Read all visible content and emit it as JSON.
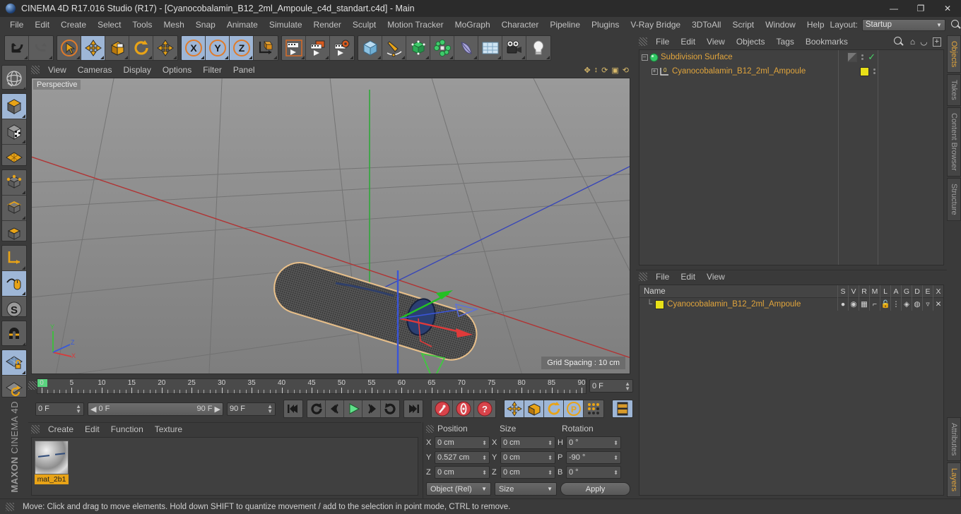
{
  "window": {
    "title": "CINEMA 4D R17.016 Studio (R17) - [Cyanocobalamin_B12_2ml_Ampoule_c4d_standart.c4d] - Main",
    "minimize": "—",
    "maximize": "❐",
    "close": "✕"
  },
  "menubar": {
    "items": [
      "File",
      "Edit",
      "Create",
      "Select",
      "Tools",
      "Mesh",
      "Snap",
      "Animate",
      "Simulate",
      "Render",
      "Sculpt",
      "Motion Tracker",
      "MoGraph",
      "Character",
      "Pipeline",
      "Plugins",
      "V-Ray Bridge",
      "3DToAll",
      "Script",
      "Window",
      "Help"
    ],
    "layout_label": "Layout:",
    "layout_value": "Startup"
  },
  "toolbar": {
    "groups": [
      {
        "buttons": [
          {
            "name": "undo-icon",
            "active": false
          },
          {
            "name": "redo-icon",
            "active": false
          }
        ]
      },
      {
        "buttons": [
          {
            "name": "live-selection-icon",
            "active": false
          },
          {
            "name": "move-tool-icon",
            "active": true
          },
          {
            "name": "scale-tool-icon",
            "active": false
          },
          {
            "name": "rotate-tool-icon",
            "active": false
          },
          {
            "name": "move-axis-icon",
            "active": false
          }
        ]
      },
      {
        "buttons": [
          {
            "name": "axis-x-icon",
            "active": true
          },
          {
            "name": "axis-y-icon",
            "active": true
          },
          {
            "name": "axis-z-icon",
            "active": true
          },
          {
            "name": "world-object-coordinate-icon",
            "active": false
          }
        ]
      },
      {
        "buttons": [
          {
            "name": "render-view-icon",
            "active": false
          },
          {
            "name": "render-to-picture-viewer-icon",
            "active": false
          },
          {
            "name": "render-settings-icon",
            "active": false
          }
        ]
      },
      {
        "buttons": [
          {
            "name": "cube-primitive-icon",
            "active": false
          },
          {
            "name": "spline-pen-icon",
            "active": false
          },
          {
            "name": "generator-nurbs-icon",
            "active": false
          },
          {
            "name": "mograph-icon",
            "active": false
          },
          {
            "name": "deformer-icon",
            "active": false
          },
          {
            "name": "floor-environment-icon",
            "active": false
          },
          {
            "name": "camera-icon",
            "active": false
          },
          {
            "name": "light-icon",
            "active": false
          }
        ]
      }
    ]
  },
  "lefttoolbar": {
    "groups": [
      {
        "buttons": [
          {
            "name": "make-editable-globe-icon",
            "active": false
          }
        ]
      },
      {
        "buttons": [
          {
            "name": "model-mode-icon",
            "active": true
          },
          {
            "name": "texture-mode-icon",
            "active": false
          },
          {
            "name": "workplane-mode-icon",
            "active": false
          }
        ]
      },
      {
        "buttons": [
          {
            "name": "points-mode-icon",
            "active": false
          },
          {
            "name": "edges-mode-icon",
            "active": false
          },
          {
            "name": "polygons-mode-icon",
            "active": false
          }
        ]
      },
      {
        "buttons": [
          {
            "name": "object-axis-mode-icon",
            "active": false
          },
          {
            "name": "enable-snapping-icon",
            "active": true
          },
          {
            "name": "soft-selection-icon",
            "active": false
          }
        ]
      },
      {
        "buttons": [
          {
            "name": "magnet-tool-icon",
            "active": false
          }
        ]
      },
      {
        "buttons": [
          {
            "name": "lock-workplane-icon",
            "active": true
          },
          {
            "name": "planar-workplane-icon",
            "active": false
          }
        ]
      }
    ],
    "brand_bold": "MAXON",
    "brand": "CINEMA 4D"
  },
  "viewport": {
    "menu": [
      "View",
      "Cameras",
      "Display",
      "Options",
      "Filter",
      "Panel"
    ],
    "view_label": "Perspective",
    "grid_spacing": "Grid Spacing : 10 cm",
    "axis_labels": {
      "x": "X",
      "y": "Y",
      "z": "Z"
    },
    "colors": {
      "axis_x": "#d83a3a",
      "axis_y": "#3ac13a",
      "axis_z": "#3a5ad8",
      "selection_outline": "#e9c08a",
      "background_top": "#9a9a9a",
      "background_bottom": "#7e7e7e"
    }
  },
  "timeline": {
    "ticks": [
      "0",
      "5",
      "10",
      "15",
      "20",
      "25",
      "30",
      "35",
      "40",
      "45",
      "50",
      "55",
      "60",
      "65",
      "70",
      "75",
      "80",
      "85",
      "90"
    ],
    "current_frame_right": "0 F",
    "start_field": "0 F",
    "range_start": "0 F",
    "range_end": "90 F",
    "end_field": "90 F",
    "transport": [
      {
        "name": "go-to-start-button"
      },
      {
        "name": "play-backwards-button"
      },
      {
        "name": "previous-frame-button"
      },
      {
        "name": "play-forwards-button"
      },
      {
        "name": "next-frame-button"
      },
      {
        "name": "loop-button"
      },
      {
        "name": "go-to-end-button"
      }
    ],
    "keyframe_buttons": [
      {
        "name": "record-active-objects-button"
      },
      {
        "name": "autokeying-button"
      },
      {
        "name": "keyframe-selection-button"
      }
    ],
    "key_toggles": [
      {
        "name": "key-position-icon",
        "active": true
      },
      {
        "name": "key-scale-icon",
        "active": true
      },
      {
        "name": "key-rotation-icon",
        "active": true
      },
      {
        "name": "key-param-icon",
        "active": true
      },
      {
        "name": "key-pla-icon",
        "active": false
      }
    ],
    "timeline_button": {
      "name": "timeline-button",
      "active": true
    }
  },
  "materials": {
    "menu": [
      "Create",
      "Edit",
      "Function",
      "Texture"
    ],
    "items": [
      {
        "name": "mat_2b1"
      }
    ]
  },
  "coordinates": {
    "headers": [
      "Position",
      "Size",
      "Rotation"
    ],
    "position": {
      "x_label": "X",
      "x": "0 cm",
      "y_label": "Y",
      "y": "0.527 cm",
      "z_label": "Z",
      "z": "0 cm"
    },
    "size": {
      "x_label": "X",
      "x": "0 cm",
      "y_label": "Y",
      "y": "0 cm",
      "z_label": "Z",
      "z": "0 cm"
    },
    "rotation": {
      "h_label": "H",
      "h": "0 °",
      "p_label": "P",
      "p": "-90 °",
      "b_label": "B",
      "b": "0 °"
    },
    "mode_dropdown": "Object (Rel)",
    "size_dropdown": "Size",
    "apply_button": "Apply"
  },
  "objectmanager": {
    "menu": [
      "File",
      "Edit",
      "View",
      "Objects",
      "Tags",
      "Bookmarks"
    ],
    "icons": [
      "search-icon",
      "home-icon",
      "ellipse-icon",
      "expand-icon"
    ],
    "rows": [
      {
        "name": "Subdivision Surface",
        "icon": "subdivision-surface-icon",
        "indent": 0,
        "expanded": true,
        "tag": "halfsplit",
        "check": true
      },
      {
        "name": "Cyanocobalamin_B12_2ml_Ampoule",
        "icon": "polygon-object-icon",
        "indent": 1,
        "expanded": true,
        "tag": "yellow",
        "check": false
      }
    ]
  },
  "layermanager": {
    "menu": [
      "File",
      "Edit",
      "View"
    ],
    "columns": [
      "Name",
      "S",
      "V",
      "R",
      "M",
      "L",
      "A",
      "G",
      "D",
      "E",
      "X"
    ],
    "rows": [
      {
        "name": "Cyanocobalamin_B12_2ml_Ampoule",
        "color": "#e8e018"
      }
    ]
  },
  "vtabs_top": [
    {
      "label": "Objects",
      "active": true
    },
    {
      "label": "Takes",
      "active": false
    },
    {
      "label": "Content Browser",
      "active": false
    },
    {
      "label": "Structure",
      "active": false
    }
  ],
  "vtabs_bottom": [
    {
      "label": "Attributes",
      "active": false
    },
    {
      "label": "Layers",
      "active": true
    }
  ],
  "status": {
    "text": "Move: Click and drag to move elements. Hold down SHIFT to quantize movement / add to the selection in point mode, CTRL to remove."
  }
}
